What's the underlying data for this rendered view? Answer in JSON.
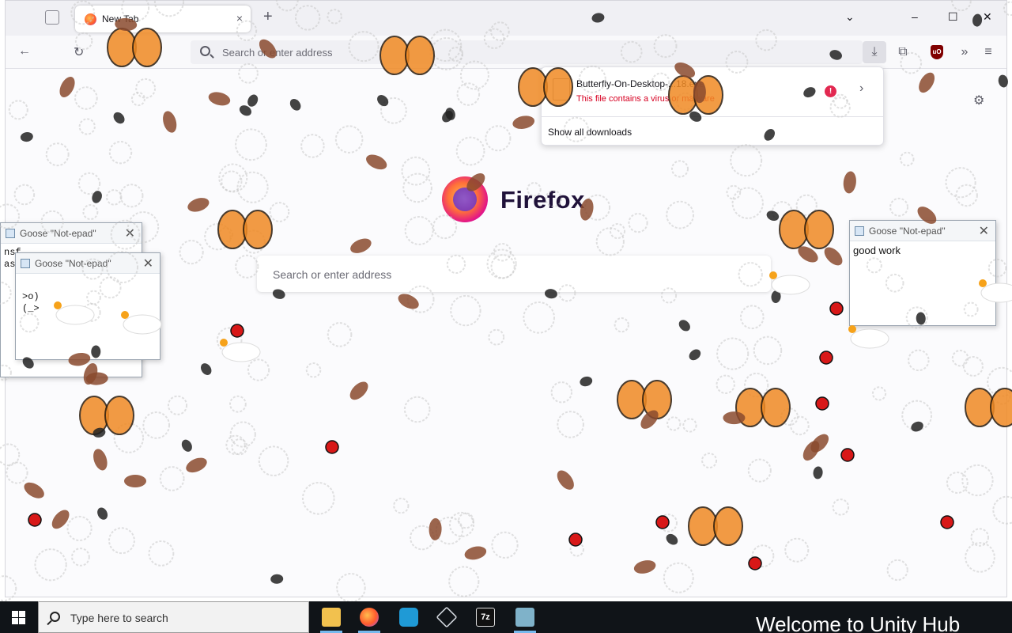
{
  "browser": {
    "tab_title": "New Tab",
    "tab_close": "×",
    "new_tab": "+",
    "url_placeholder": "Search or enter address",
    "window_controls": {
      "list": "⌄",
      "minimize": "–",
      "maximize": "☐",
      "close": "✕"
    },
    "toolbar": {
      "back": "←",
      "reload": "↻",
      "download": "⤓",
      "extensions": "⧉",
      "ublock": "uO",
      "overflow": "»",
      "menu": "≡"
    }
  },
  "downloads_panel": {
    "file_name": "Butterfly-On-Desktop-...18.exe",
    "warning": "This file contains a virus or malware",
    "alert_icon": "!",
    "arrow": "›",
    "show_all": "Show all downloads"
  },
  "newtab": {
    "wordmark": "Firefox",
    "search_placeholder": "Search or enter address",
    "settings_icon": "⚙"
  },
  "notepads": [
    {
      "title": "Goose \"Not-epad\"",
      "close": "✕",
      "body": "nsf\nasc"
    },
    {
      "title": "Goose \"Not-epad\"",
      "close": "✕",
      "body": ">o)\n(_>"
    },
    {
      "title": "Goose \"Not-epad\"",
      "close": "✕",
      "body": "good work"
    }
  ],
  "taskbar": {
    "search_placeholder": "Type here to search",
    "unity_banner": "Welcome to Unity Hub",
    "apps": [
      "file-explorer-icon",
      "firefox-icon",
      "app-icon",
      "unity-icon",
      "7zip-icon",
      "app-icon"
    ]
  },
  "colors": {
    "warning_red": "#d70022",
    "taskbar": "#101418",
    "firefox_dark": "#20123a"
  }
}
